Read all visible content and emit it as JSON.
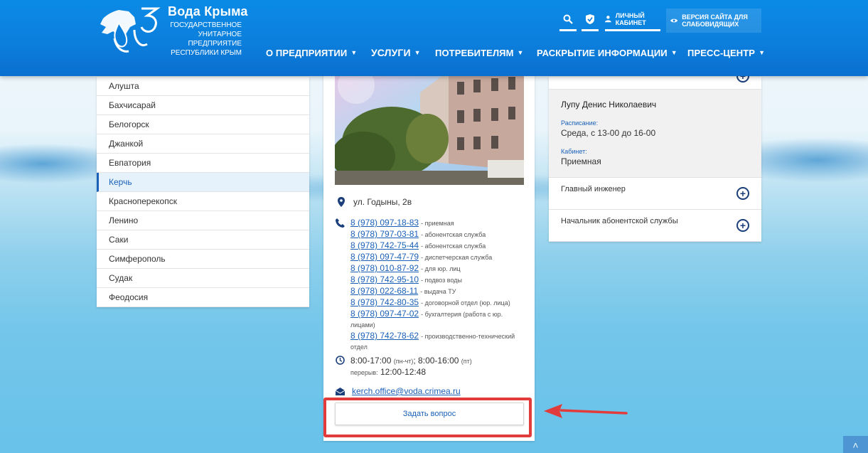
{
  "header": {
    "brand_title": "Вода Крыма",
    "brand_subtitle": "ГОСУДАРСТВЕННОЕ УНИТАРНОЕ ПРЕДПРИЯТИЕ РЕСПУБЛИКИ КРЫМ",
    "cabinet_label": "ЛИЧНЫЙ КАБИНЕТ",
    "vision_label": "ВЕРСИЯ САЙТА ДЛЯ СЛАБОВИДЯЩИХ",
    "nav": [
      {
        "label": "О ПРЕДПРИЯТИИ"
      },
      {
        "label": "УСЛУГИ"
      },
      {
        "label": "ПОТРЕБИТЕЛЯМ"
      },
      {
        "label": "РАСКРЫТИЕ ИНФОРМАЦИИ"
      },
      {
        "label": "ПРЕСС-ЦЕНТР"
      }
    ]
  },
  "cities": [
    "Алушта",
    "Бахчисарай",
    "Белогорск",
    "Джанкой",
    "Евпатория",
    "Керчь",
    "Красноперекопск",
    "Ленино",
    "Саки",
    "Симферополь",
    "Судак",
    "Феодосия"
  ],
  "active_city": "Керчь",
  "office": {
    "address": "ул. Годыны, 2в",
    "phones": [
      {
        "number": "8 (978) 097-18-83",
        "desc": "- приемная"
      },
      {
        "number": "8 (978) 797-03-81",
        "desc": "- абонентская служба"
      },
      {
        "number": "8 (978) 742-75-44",
        "desc": "- абонентская служба"
      },
      {
        "number": "8 (978) 097-47-79",
        "desc": "- диспетчерская служба"
      },
      {
        "number": "8 (978) 010-87-92",
        "desc": "- для юр. лиц"
      },
      {
        "number": "8 (978) 742-95-10",
        "desc": "- подвоз воды"
      },
      {
        "number": "8 (978) 022-68-11",
        "desc": "- выдача ТУ"
      },
      {
        "number": "8 (978) 742-80-35",
        "desc": "- договорной отдел (юр. лица)"
      },
      {
        "number": "8 (978) 097-47-02",
        "desc": "- бухгалтерия (работа с юр. лицами)"
      },
      {
        "number": "8 (978) 742-78-62",
        "desc": "- производственно-технический отдел"
      }
    ],
    "hours_main": "8:00-17:00",
    "hours_main_note": "(пн-чт)",
    "hours_fri": "; 8:00-16:00",
    "hours_fri_note": "(пт)",
    "break_label": "перерыв:",
    "break_time": "12:00-12:48",
    "email": "kerch.office@voda.crimea.ru",
    "ask_button": "Задать вопрос"
  },
  "staff": {
    "open": {
      "name": "Лупу Денис Николаевич",
      "schedule_label": "Расписание:",
      "schedule_value": "Среда, с 13-00 до 16-00",
      "room_label": "Кабинет:",
      "room_value": "Приемная"
    },
    "rows": [
      {
        "title": "Главный инженер"
      },
      {
        "title": "Начальник абонентской службы"
      }
    ]
  },
  "colors": {
    "header_blue": "#0c7fdc",
    "link_blue": "#1a60b8",
    "highlight_red": "#e13b3b"
  }
}
